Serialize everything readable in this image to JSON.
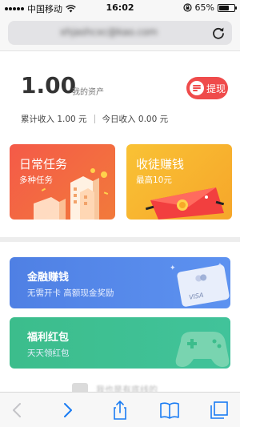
{
  "status_bar": {
    "carrier": "中国移动",
    "time": "16:02",
    "battery": "65%",
    "battery_level": 0.65
  },
  "browser": {
    "url": "xhjashcxc@kao.com"
  },
  "assets": {
    "balance": "1.00",
    "balance_label": "我的资产",
    "withdraw_label": "提现",
    "total_income": "累计收入 1.00 元",
    "today_income": "今日收入 0.00 元"
  },
  "cards": [
    {
      "title": "日常任务",
      "subtitle": "多种任务"
    },
    {
      "title": "收徒赚钱",
      "subtitle": "最高10元"
    }
  ],
  "banners": [
    {
      "title": "金融赚钱",
      "subtitle": "无需开卡 高额现金奖励",
      "card_text": "VISA"
    },
    {
      "title": "福利红包",
      "subtitle": "天天领红包"
    }
  ],
  "footer_hint": "我也是有底线的",
  "colors": {
    "accent_red": "#ef4b4b",
    "card_orange": "#f45a48",
    "card_yellow": "#f9c235",
    "banner_blue": "#4f80e4",
    "banner_green": "#3cbd8c",
    "ios_blue": "#1a7cf3"
  },
  "icons": [
    "signal-icon",
    "wifi-icon",
    "lock-rotation-icon",
    "battery-icon",
    "reload-icon",
    "withdraw-icon",
    "back-icon",
    "forward-icon",
    "share-icon",
    "bookmarks-icon",
    "tabs-icon"
  ]
}
